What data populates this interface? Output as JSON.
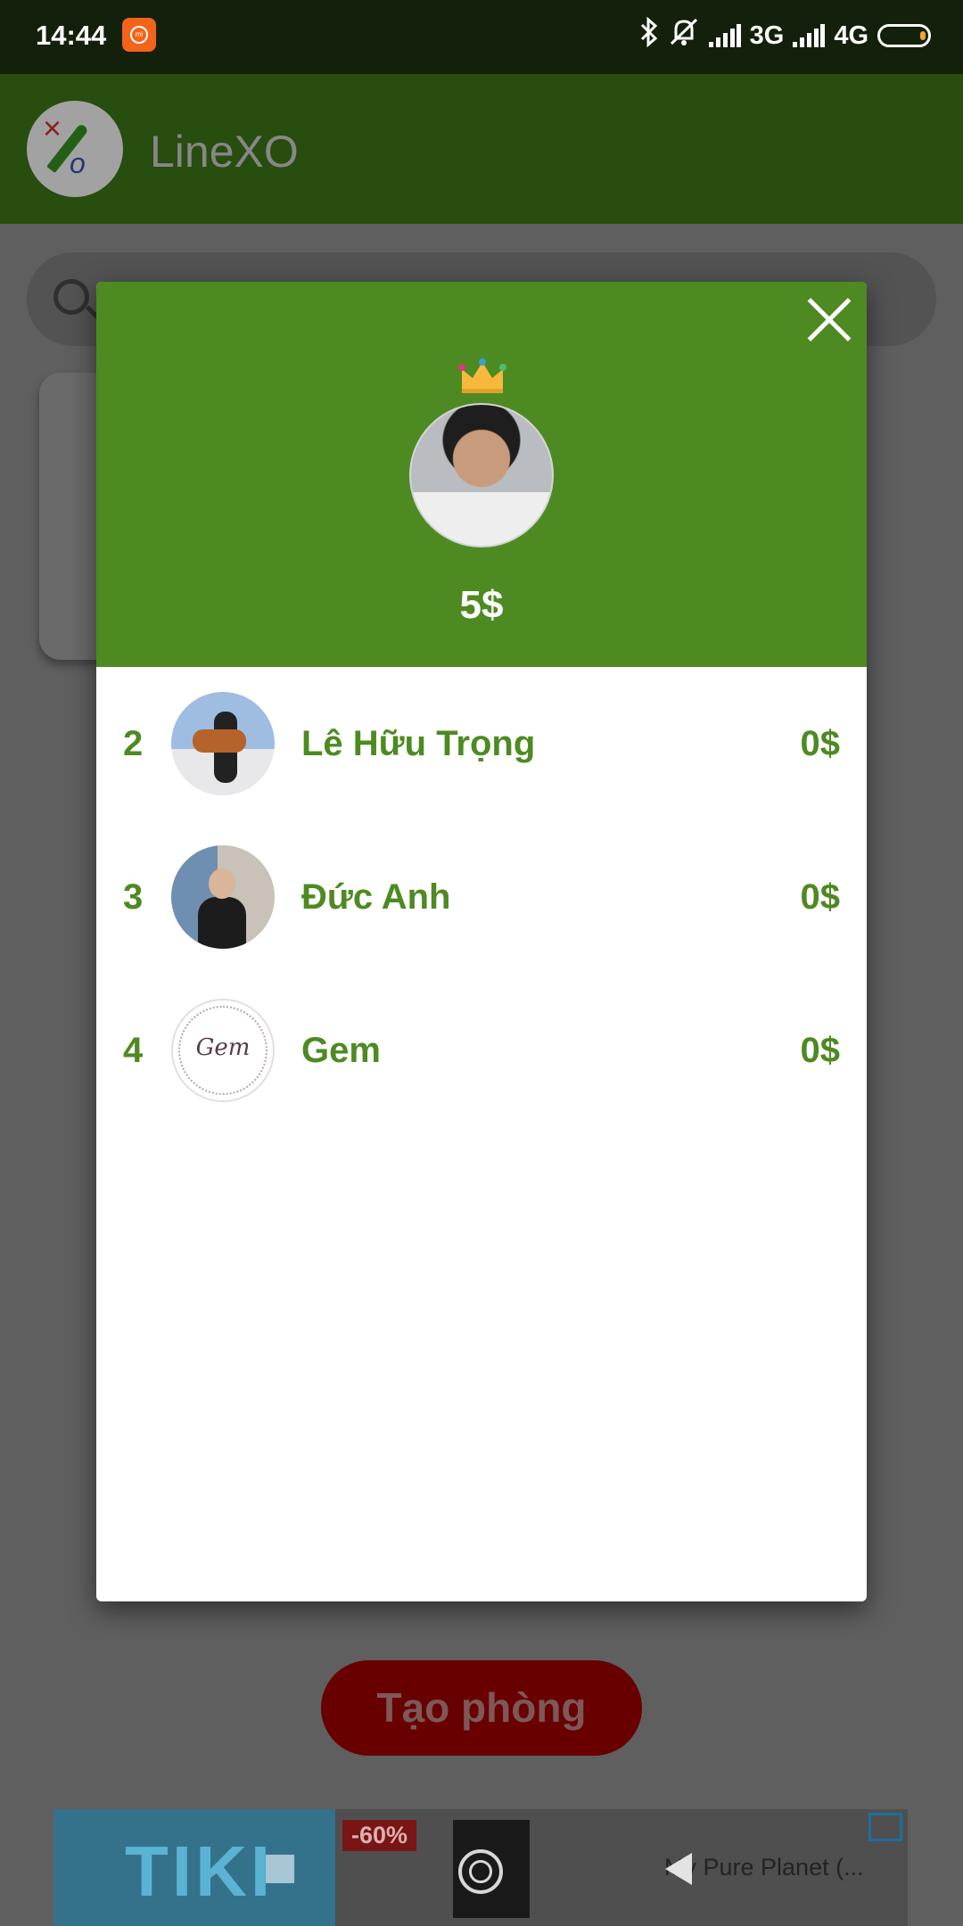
{
  "status_bar": {
    "time": "14:44",
    "network_1": "3G",
    "network_2": "4G"
  },
  "app_bar": {
    "title": "LineXO"
  },
  "background": {
    "create_room_label": "Tạo phòng"
  },
  "leaderboard": {
    "top_player": {
      "score": "5$"
    },
    "rows": [
      {
        "rank": "2",
        "name": "Lê Hữu Trọng",
        "score": "0$"
      },
      {
        "rank": "3",
        "name": "Đức Anh",
        "score": "0$"
      },
      {
        "rank": "4",
        "name": "Gem",
        "score": "0$"
      }
    ]
  },
  "avatar_text": {
    "gem": "Gem"
  },
  "ad": {
    "brand": "TIKI",
    "discount": "-60%",
    "text": "My Pure Planet (..."
  },
  "colors": {
    "header_green": "#4e8a22",
    "text_green": "#4e8a22",
    "create_button": "#8b0000"
  }
}
